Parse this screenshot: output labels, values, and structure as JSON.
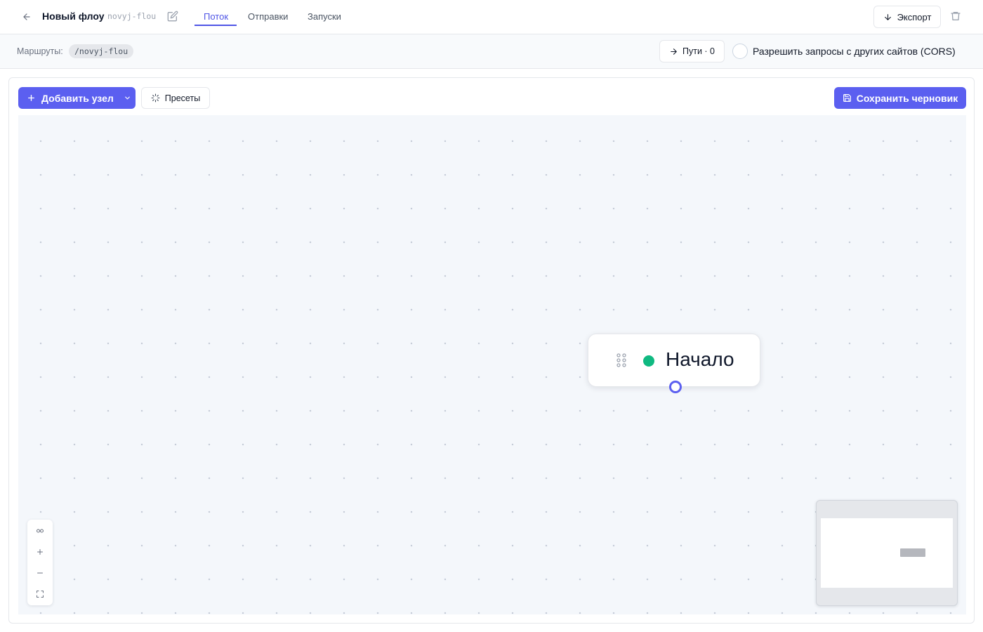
{
  "header": {
    "title": "Новый флоу",
    "slug": "novyj-flou",
    "tabs": [
      {
        "label": "Поток",
        "active": true
      },
      {
        "label": "Отправки",
        "active": false
      },
      {
        "label": "Запуски",
        "active": false
      }
    ],
    "export_label": "Экспорт"
  },
  "routes": {
    "label": "Маршруты:",
    "chip": "/novyj-flou",
    "paths_label": "Пути · 0",
    "cors_label": "Разрешить запросы с других сайтов (CORS)",
    "cors_enabled": false
  },
  "toolbar": {
    "add_node_label": "Добавить узел",
    "presets_label": "Пресеты",
    "save_label": "Сохранить черновик"
  },
  "canvas": {
    "start_node_label": "Начало"
  },
  "colors": {
    "accent": "#5b5ff0",
    "status_ok": "#10b981"
  },
  "icons": {
    "back": "arrow-left-icon",
    "edit": "pencil-square-icon",
    "export": "arrow-down-icon",
    "delete": "trash-icon",
    "paths": "arrow-right-icon",
    "add": "plus-icon",
    "presets": "loader-icon",
    "save": "floppy-disk-icon",
    "drag": "grip-icon"
  }
}
